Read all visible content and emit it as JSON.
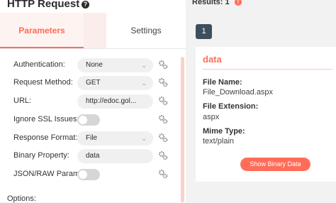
{
  "node": {
    "title": "HTTP Request",
    "help_icon": "?",
    "tabs": {
      "parameters": "Parameters",
      "settings": "Settings"
    }
  },
  "parameters": {
    "authentication": {
      "label": "Authentication:",
      "value": "None"
    },
    "request_method": {
      "label": "Request Method:",
      "value": "GET"
    },
    "url": {
      "label": "URL:",
      "value": "http://edoc.gol..."
    },
    "ignore_ssl": {
      "label": "Ignore SSL Issues:",
      "on": false
    },
    "response_format": {
      "label": "Response Format:",
      "value": "File"
    },
    "binary_property": {
      "label": "Binary Property:",
      "value": "data"
    },
    "json_raw": {
      "label": "JSON/RAW Param...",
      "on": false
    }
  },
  "options_label": "Options:",
  "results": {
    "label": "Results: 1",
    "warning_icon": "!",
    "page": "1",
    "card": {
      "title": "data",
      "file_name_label": "File Name:",
      "file_name_value": "File_Download.aspx",
      "file_ext_label": "File Extension:",
      "file_ext_value": "aspx",
      "mime_label": "Mime Type:",
      "mime_value": "text/plain",
      "show_button": "Show Binary Data"
    }
  },
  "colors": {
    "accent": "#ff6d5a",
    "page_button": "#3e4f5c"
  },
  "icons": {
    "gear": "gear-icon",
    "chevron": "chevron-down-icon"
  }
}
